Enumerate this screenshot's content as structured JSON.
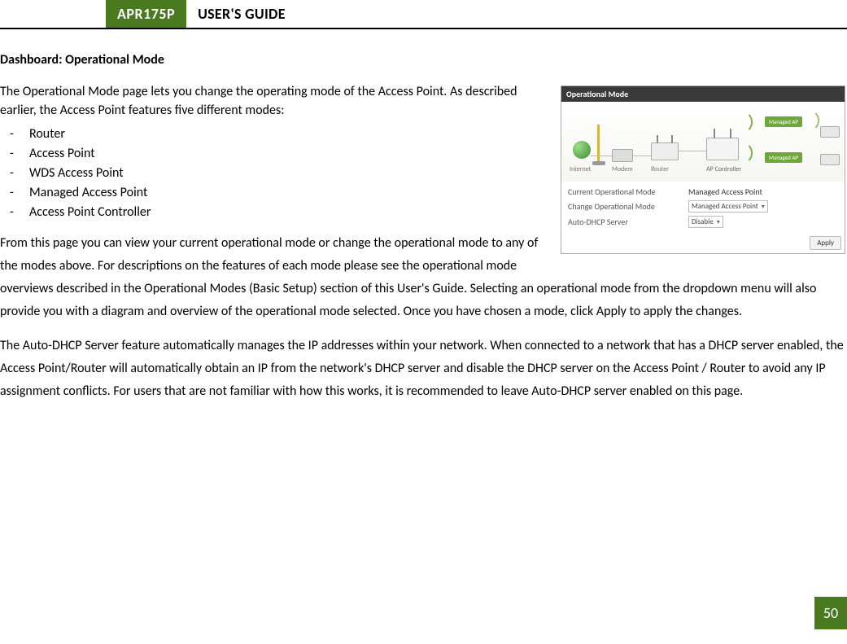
{
  "header": {
    "badge": "APR175P",
    "title": "USER'S GUIDE"
  },
  "section_title": "Dashboard: Operational Mode",
  "intro": "The Operational Mode page lets you change the operating mode of the Access Point. As described earlier, the Access Point features five different modes:",
  "modes": [
    "Router",
    "Access Point",
    "WDS Access Point",
    "Managed Access Point",
    "Access Point Controller"
  ],
  "para1": "From this page you can view your current operational mode or change the operational mode to any of the modes above. For descriptions on the features of each mode please see the operational mode overviews described in the Operational Modes (Basic Setup) section of this User's Guide. Selecting an operational mode from the dropdown menu will also provide you with a diagram and overview of the operational mode selected. Once you have chosen a mode, click Apply to apply the changes.",
  "para2": "The Auto-DHCP Server feature automatically manages the IP addresses within your network. When connected to a network that has a DHCP server enabled, the Access Point/Router will automatically obtain an IP from the network's DHCP server and disable the DHCP server on the Access Point / Router to avoid any IP assignment conflicts. For users that are not familiar with how this works, it is recommended to leave Auto-DHCP server enabled on this page.",
  "figure": {
    "header": "Operational Mode",
    "labels": {
      "internet": "Internet",
      "modem": "Modem",
      "router": "Router",
      "controller": "AP Controller",
      "managed_ap": "Managed AP"
    },
    "row1_label": "Current Operational Mode",
    "row1_value": "Managed Access Point",
    "row2_label": "Change Operational Mode",
    "row2_value": "Managed Access Point",
    "row3_label": "Auto-DHCP Server",
    "row3_value": "Disable",
    "apply": "Apply"
  },
  "page_number": "50"
}
